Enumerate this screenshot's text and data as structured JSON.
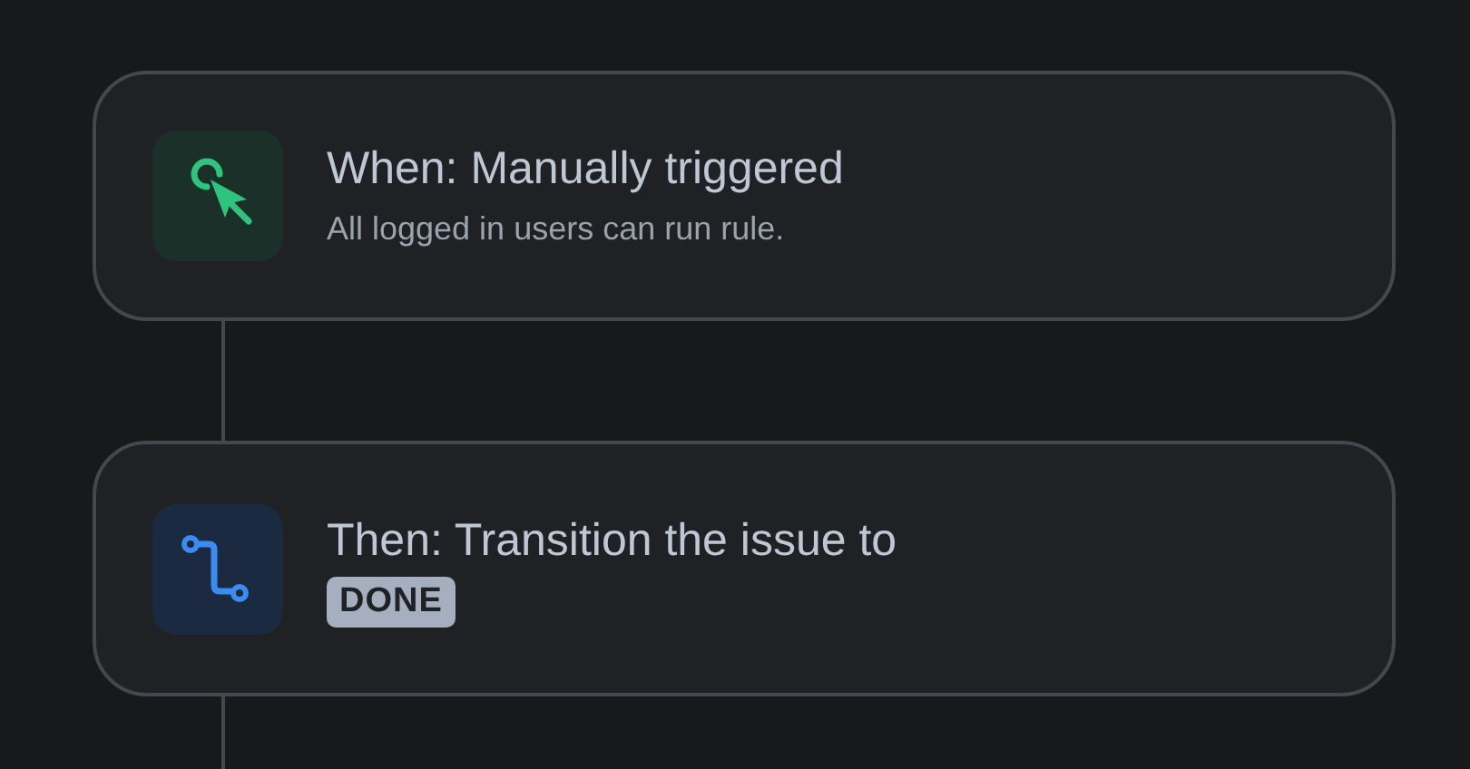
{
  "steps": [
    {
      "kind": "trigger",
      "title": "When: Manually triggered",
      "subtitle": "All logged in users can run rule."
    },
    {
      "kind": "action",
      "title": "Then: Transition the issue to",
      "badge": "DONE"
    }
  ]
}
